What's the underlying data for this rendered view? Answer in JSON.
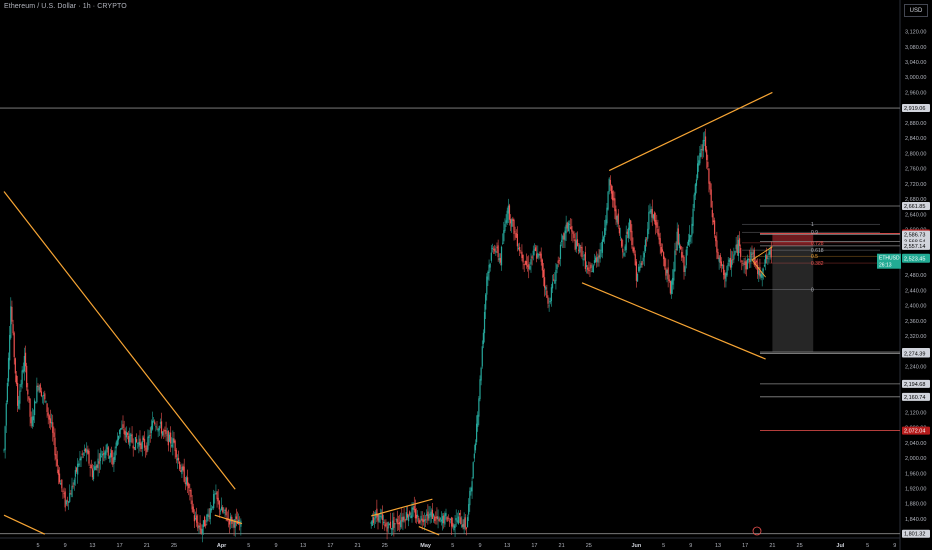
{
  "header": {
    "title": "Ethereum / U.S. Dollar · 1h · CRYPTO",
    "currency": "USD"
  },
  "colors": {
    "background": "#000000",
    "up_candle": "#26a69a",
    "down_candle": "#ef5350",
    "trendline": "#f7a534",
    "level_line": "#8a8a8a",
    "axis_text": "#b2b5be",
    "current_price": "#22ab94",
    "red_level": "#b71c1c",
    "short_zone": "#262626",
    "stop_zone": "#6d1a1e"
  },
  "chart_data": {
    "type": "candlestick",
    "symbol": "ETHUSD",
    "timeframe": "1h",
    "ylim": [
      1790,
      3140
    ],
    "y_ticks": [
      1840,
      1880,
      1920,
      1960,
      2000,
      2040,
      2080,
      2120,
      2160,
      2200,
      2240,
      2280,
      2320,
      2360,
      2400,
      2440,
      2480,
      2520,
      2560,
      2600,
      2640,
      2680,
      2720,
      2760,
      2800,
      2840,
      2880,
      2920,
      2960,
      3000,
      3040,
      3080,
      3120
    ],
    "x_ticks": [
      {
        "label": "5",
        "x": 5
      },
      {
        "label": "9",
        "x": 9
      },
      {
        "label": "13",
        "x": 13
      },
      {
        "label": "17",
        "x": 17
      },
      {
        "label": "21",
        "x": 21
      },
      {
        "label": "25",
        "x": 25
      },
      {
        "label": "Apr",
        "x": 32,
        "bold": true
      },
      {
        "label": "5",
        "x": 36
      },
      {
        "label": "9",
        "x": 40
      },
      {
        "label": "13",
        "x": 44
      },
      {
        "label": "17",
        "x": 48
      },
      {
        "label": "21",
        "x": 52
      },
      {
        "label": "25",
        "x": 56
      },
      {
        "label": "May",
        "x": 62,
        "bold": true
      },
      {
        "label": "5",
        "x": 66
      },
      {
        "label": "9",
        "x": 70
      },
      {
        "label": "13",
        "x": 74
      },
      {
        "label": "17",
        "x": 78
      },
      {
        "label": "21",
        "x": 82
      },
      {
        "label": "25",
        "x": 86
      },
      {
        "label": "Jun",
        "x": 93,
        "bold": true
      },
      {
        "label": "5",
        "x": 97
      },
      {
        "label": "9",
        "x": 101
      },
      {
        "label": "13",
        "x": 105
      },
      {
        "label": "17",
        "x": 109
      },
      {
        "label": "21",
        "x": 113
      },
      {
        "label": "25",
        "x": 117
      },
      {
        "label": "Jul",
        "x": 123,
        "bold": true
      },
      {
        "label": "5",
        "x": 127
      },
      {
        "label": "9",
        "x": 131
      }
    ],
    "horizontal_levels": [
      {
        "price": 2919.06,
        "label": "2,919.06",
        "style": "gray"
      },
      {
        "price": 2661.85,
        "label": "2,661.85",
        "style": "gray"
      },
      {
        "price": 2589.85,
        "label": "2,589.85",
        "style": "red"
      },
      {
        "price": 2586.73,
        "label": "2,586.73",
        "style": "gray"
      },
      {
        "price": 2568.54,
        "label": "2,568.54",
        "style": "gray"
      },
      {
        "price": 2557.14,
        "label": "2,557.14",
        "style": "gray"
      },
      {
        "price": 2278.31,
        "label": "2,278.31",
        "style": "gray"
      },
      {
        "price": 2274.39,
        "label": "2,274.39",
        "style": "gray"
      },
      {
        "price": 2194.68,
        "label": "2,194.68",
        "style": "gray"
      },
      {
        "price": 2160.74,
        "label": "2,160.74",
        "style": "gray"
      },
      {
        "price": 2072.04,
        "label": "2,072.04",
        "style": "red"
      },
      {
        "price": 1801.32,
        "label": "1,801.32",
        "style": "gray"
      }
    ],
    "current_price": {
      "label": "ETHUSD",
      "value": "2,523.45",
      "countdown": "26:13"
    },
    "fibonacci": [
      {
        "level": "1",
        "price": 2614,
        "color": "#b2b5be"
      },
      {
        "level": "0.9",
        "price": 2593,
        "color": "#b2b5be"
      },
      {
        "level": "0.728",
        "price": 2565,
        "color": "#ef5350"
      },
      {
        "level": "0.618",
        "price": 2546,
        "color": "#b2b5be"
      },
      {
        "level": "0.5",
        "price": 2530,
        "color": "#f7a534"
      },
      {
        "level": "0.382",
        "price": 2512,
        "color": "#ef5350"
      },
      {
        "level": "0",
        "price": 2443,
        "color": "#b2b5be"
      }
    ],
    "trendlines": [
      {
        "from": [
          0,
          2700
        ],
        "to": [
          34,
          1918
        ]
      },
      {
        "from": [
          0,
          1850
        ],
        "to": [
          6,
          1800
        ]
      },
      {
        "from": [
          31,
          1850
        ],
        "to": [
          35,
          1828
        ]
      },
      {
        "from": [
          54,
          1848
        ],
        "to": [
          63,
          1892
        ]
      },
      {
        "from": [
          61,
          1820
        ],
        "to": [
          64,
          1798
        ]
      },
      {
        "from": [
          85,
          2460
        ],
        "to": [
          112,
          2260
        ]
      },
      {
        "from": [
          89,
          2755
        ],
        "to": [
          113,
          2960
        ]
      }
    ],
    "candles_summary": [
      [
        0,
        2020
      ],
      [
        1,
        2400
      ],
      [
        2,
        2140
      ],
      [
        3,
        2260
      ],
      [
        4,
        2080
      ],
      [
        5,
        2200
      ],
      [
        6,
        2150
      ],
      [
        7,
        2080
      ],
      [
        8,
        1960
      ],
      [
        9,
        1880
      ],
      [
        10,
        1920
      ],
      [
        11,
        1990
      ],
      [
        12,
        2020
      ],
      [
        13,
        1960
      ],
      [
        14,
        2000
      ],
      [
        15,
        2030
      ],
      [
        16,
        1990
      ],
      [
        17,
        2080
      ],
      [
        18,
        2060
      ],
      [
        19,
        2040
      ],
      [
        20,
        2040
      ],
      [
        21,
        2030
      ],
      [
        22,
        2100
      ],
      [
        23,
        2080
      ],
      [
        24,
        2050
      ],
      [
        25,
        2040
      ],
      [
        26,
        1970
      ],
      [
        27,
        1930
      ],
      [
        28,
        1840
      ],
      [
        29,
        1810
      ],
      [
        30,
        1850
      ],
      [
        31,
        1900
      ],
      [
        32,
        1860
      ],
      [
        33,
        1840
      ],
      [
        34,
        1830
      ],
      [
        35,
        1820
      ],
      [
        54,
        1840
      ],
      [
        55,
        1850
      ],
      [
        56,
        1820
      ],
      [
        57,
        1825
      ],
      [
        58,
        1835
      ],
      [
        59,
        1850
      ],
      [
        60,
        1860
      ],
      [
        61,
        1840
      ],
      [
        62,
        1850
      ],
      [
        63,
        1850
      ],
      [
        64,
        1830
      ],
      [
        65,
        1845
      ],
      [
        66,
        1830
      ],
      [
        67,
        1840
      ],
      [
        68,
        1820
      ],
      [
        69,
        1980
      ],
      [
        70,
        2200
      ],
      [
        71,
        2480
      ],
      [
        72,
        2560
      ],
      [
        73,
        2520
      ],
      [
        74,
        2660
      ],
      [
        75,
        2600
      ],
      [
        76,
        2540
      ],
      [
        77,
        2500
      ],
      [
        78,
        2540
      ],
      [
        79,
        2520
      ],
      [
        80,
        2400
      ],
      [
        81,
        2480
      ],
      [
        82,
        2560
      ],
      [
        83,
        2620
      ],
      [
        84,
        2560
      ],
      [
        85,
        2540
      ],
      [
        86,
        2480
      ],
      [
        87,
        2520
      ],
      [
        88,
        2560
      ],
      [
        89,
        2720
      ],
      [
        90,
        2640
      ],
      [
        91,
        2540
      ],
      [
        92,
        2620
      ],
      [
        93,
        2480
      ],
      [
        94,
        2520
      ],
      [
        95,
        2660
      ],
      [
        96,
        2600
      ],
      [
        97,
        2520
      ],
      [
        98,
        2440
      ],
      [
        99,
        2580
      ],
      [
        100,
        2500
      ],
      [
        101,
        2600
      ],
      [
        102,
        2760
      ],
      [
        103,
        2840
      ],
      [
        104,
        2660
      ],
      [
        105,
        2520
      ],
      [
        106,
        2480
      ],
      [
        107,
        2520
      ],
      [
        108,
        2560
      ],
      [
        109,
        2500
      ],
      [
        110,
        2540
      ],
      [
        111,
        2480
      ],
      [
        112,
        2520
      ],
      [
        113,
        2540
      ]
    ],
    "position_tool": {
      "type": "short",
      "from_x": 113,
      "to_x": 119,
      "entry": 2557,
      "stop": 2590,
      "target": 2278
    }
  }
}
